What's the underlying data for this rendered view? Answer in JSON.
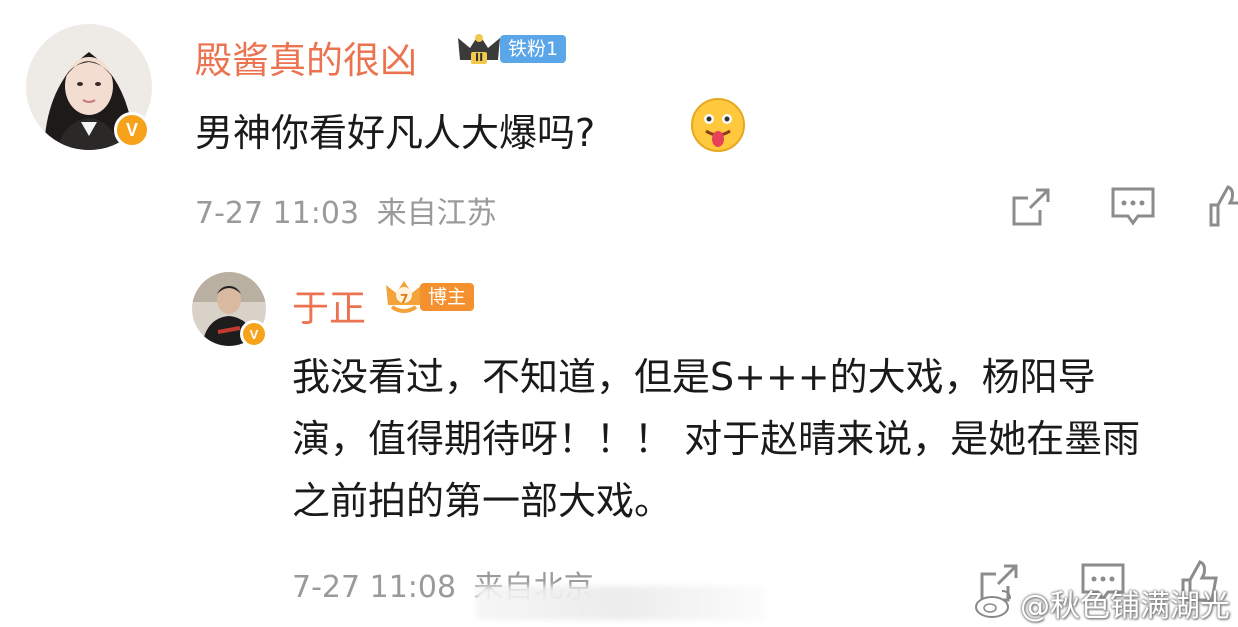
{
  "comments": [
    {
      "username": "殿酱真的很凶",
      "badge": {
        "level": "II",
        "label": "铁粉1",
        "color": "#5aa6e8"
      },
      "text": "男神你看好凡人大爆吗?",
      "emoji": "tongue-face-emoji",
      "time": "7-27 11:03",
      "location": "来自江苏",
      "verified_badge": "V"
    },
    {
      "username": "于正",
      "badge": {
        "level": "7",
        "label": "博主",
        "color": "#f4902e"
      },
      "text_lines": [
        "我没看过，不知道，但是S+++的大戏，杨阳导",
        "演，值得期待呀！！！ 对于赵晴来说，是她在墨雨",
        "之前拍的第一部大戏。"
      ],
      "time": "7-27 11:08",
      "location": "来自北京",
      "verified_badge": "V"
    }
  ],
  "actions": {
    "share_icon": "share-icon",
    "comment_icon": "comment-icon",
    "like_icon": "like-icon"
  },
  "watermark": "@秋色铺满湖光",
  "colors": {
    "username": "#eb7350",
    "meta": "#9a9a9a",
    "icon": "#8c8c8c"
  }
}
